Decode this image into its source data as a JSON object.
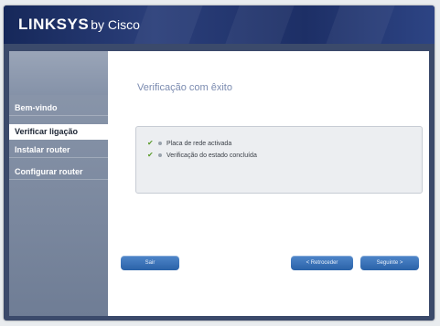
{
  "brand": {
    "name": "LINKSYS",
    "by": "by Cisco"
  },
  "sidebar": {
    "items": [
      {
        "label": "Bem-vindo",
        "active": false
      },
      {
        "label": "Verificar ligação",
        "active": true
      },
      {
        "label": "Instalar router",
        "active": false
      },
      {
        "label": "Configurar router",
        "active": false
      }
    ]
  },
  "main": {
    "heading": "Verificação com êxito",
    "status": [
      {
        "text": "Placa de rede activada",
        "icon": "checkmark-icon"
      },
      {
        "text": "Verificação do estado concluída",
        "icon": "checkmark-icon"
      }
    ]
  },
  "buttons": {
    "exit": "Sair",
    "back": "< Retroceder",
    "next": "Seguinte >"
  },
  "colors": {
    "accent": "#2a62a8",
    "check": "#5a9a2a",
    "heading": "#7b8bb0"
  }
}
